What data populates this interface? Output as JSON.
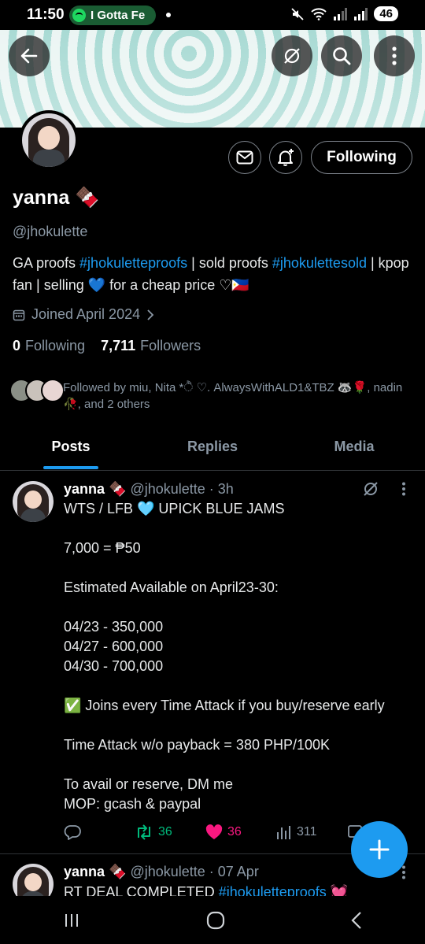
{
  "status_bar": {
    "time": "11:50",
    "media_label": "I Gotta Fe",
    "battery": "46"
  },
  "header": {
    "back_icon": "back-arrow-icon",
    "mute_icon": "hide-icon",
    "search_icon": "search-icon",
    "more_icon": "more-vertical-icon"
  },
  "profile": {
    "name": "yanna 🍫",
    "handle": "@jhokulette",
    "bio_part1": "GA proofs ",
    "bio_link1": "#jhokuletteproofs",
    "bio_part2": " | sold proofs ",
    "bio_link2": "#jhokulettesold",
    "bio_part3": " | kpop fan | selling 💙 for a cheap price ♡🇵🇭",
    "joined": "Joined April 2024",
    "following_count": "0",
    "following_label": "Following",
    "followers_count": "7,711",
    "followers_label": "Followers",
    "followed_by": "Followed by miu, Nita *ੈ ♡. AlwaysWithALD1&TBZ 🦝🌹, nadin🥀, and 2 others",
    "follow_button_label": "Following"
  },
  "tabs": [
    {
      "label": "Posts",
      "active": true
    },
    {
      "label": "Replies",
      "active": false
    },
    {
      "label": "Media",
      "active": false
    }
  ],
  "tweets": [
    {
      "name": "yanna 🍫",
      "handle_time": "@jhokulette · 3h",
      "body": "WTS / LFB 🩵 UPICK BLUE JAMS\n\n7,000 = ₱50\n\nEstimated Available on April23-30:\n\n04/23 - 350,000\n04/27 - 600,000\n04/30 - 700,000\n\n✅ Joins every Time Attack if you buy/reserve early\n\nTime Attack w/o payback = 380 PHP/100K\n\nTo avail or reserve, DM me\nMOP: gcash & paypal",
      "retweets": "36",
      "likes": "36",
      "views": "311"
    },
    {
      "name": "yanna 🍫",
      "handle_time": "@jhokulette · 07 Apr",
      "body_prefix": "RT DEAL COMPLETED ",
      "body_link": "#jhokuletteproofs",
      "body_suffix": " 💓"
    }
  ],
  "colors": {
    "accent": "#1d9bf0",
    "retweet": "#00ba7c",
    "like": "#f91880",
    "muted": "#8b98a5"
  }
}
